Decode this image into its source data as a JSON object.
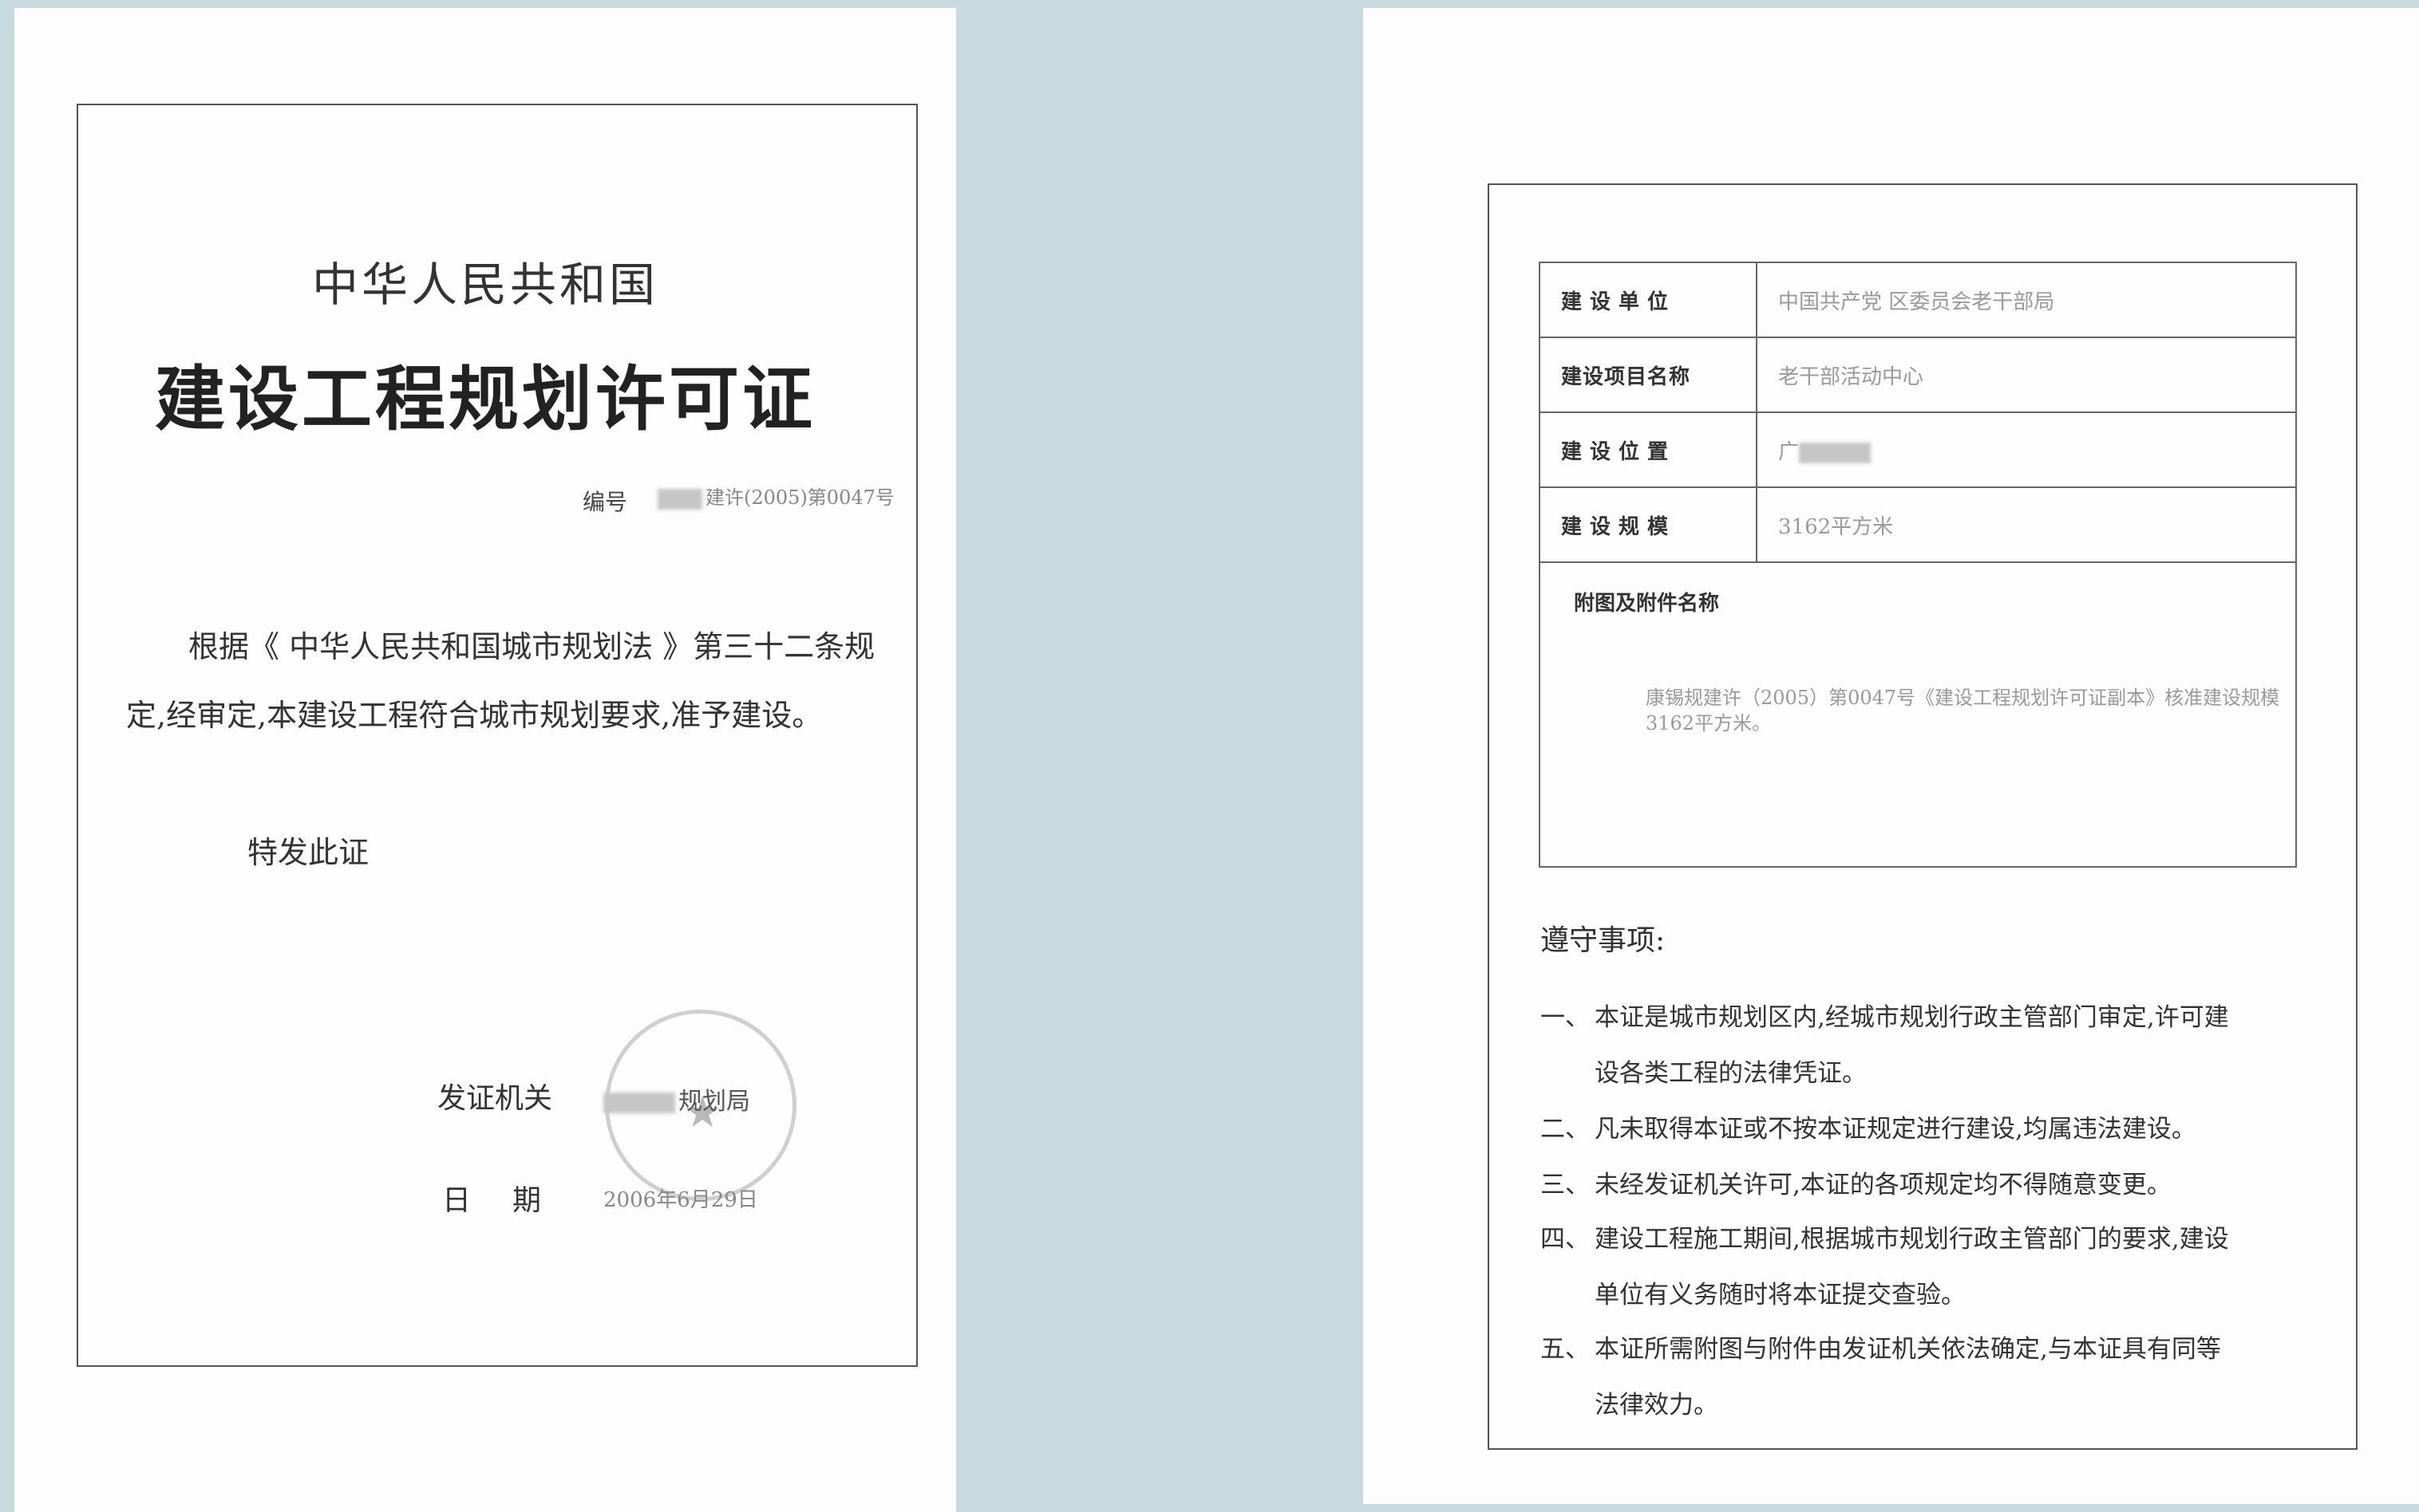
{
  "left_certificate": {
    "country": "中华人民共和国",
    "title": "建设工程规划许可证",
    "number_label": "编号",
    "number_value": "建许(2005)第0047号",
    "body_line1": "根据《 中华人民共和国城市规划法 》第三十二条规",
    "body_line2": "定,经审定,本建设工程符合城市规划要求,准予建设。",
    "special_text": "特发此证",
    "issuer_label": "发证机关",
    "issuer_value": "规划局",
    "date_label": "日期",
    "date_value": "2006年6月29日"
  },
  "right_certificate": {
    "rows": [
      {
        "label": "建设单位",
        "value": "中国共产党 区委员会老干部局"
      },
      {
        "label": "建设项目名称",
        "value": "老干部活动中心"
      },
      {
        "label": "建设位置",
        "value": "广"
      },
      {
        "label": "建设规模",
        "value": "3162平方米"
      }
    ],
    "attachments_label": "附图及附件名称",
    "attachments_text": "康锡规建许（2005）第0047号《建设工程规划许可证副本》核准建设规模3162平方米。",
    "notes_title": "遵守事项:",
    "notes": [
      {
        "num": "一、",
        "line1": "本证是城市规划区内,经城市规划行政主管部门审定,许可建",
        "line2": "设各类工程的法律凭证。"
      },
      {
        "num": "二、",
        "line1": "凡未取得本证或不按本证规定进行建设,均属违法建设。",
        "line2": ""
      },
      {
        "num": "三、",
        "line1": "未经发证机关许可,本证的各项规定均不得随意变更。",
        "line2": ""
      },
      {
        "num": "四、",
        "line1": "建设工程施工期间,根据城市规划行政主管部门的要求,建设",
        "line2": "单位有义务随时将本证提交查验。"
      },
      {
        "num": "五、",
        "line1": "本证所需附图与附件由发证机关依法确定,与本证具有同等",
        "line2": "法律效力。"
      }
    ]
  }
}
